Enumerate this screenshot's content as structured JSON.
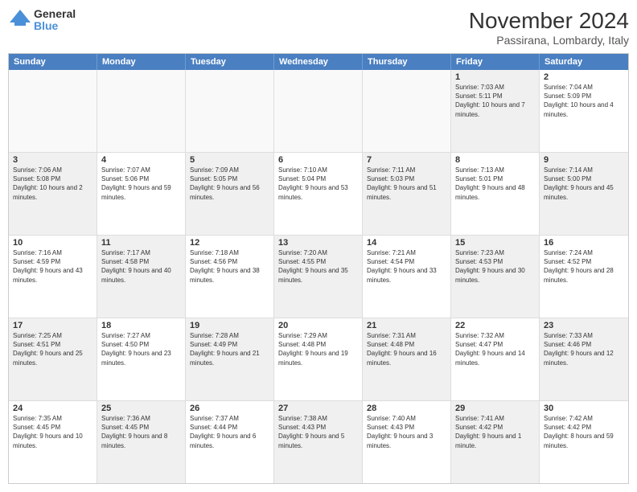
{
  "logo": {
    "general": "General",
    "blue": "Blue"
  },
  "header": {
    "month": "November 2024",
    "location": "Passirana, Lombardy, Italy"
  },
  "days_of_week": [
    "Sunday",
    "Monday",
    "Tuesday",
    "Wednesday",
    "Thursday",
    "Friday",
    "Saturday"
  ],
  "rows": [
    [
      {
        "day": "",
        "info": "",
        "empty": true
      },
      {
        "day": "",
        "info": "",
        "empty": true
      },
      {
        "day": "",
        "info": "",
        "empty": true
      },
      {
        "day": "",
        "info": "",
        "empty": true
      },
      {
        "day": "",
        "info": "",
        "empty": true
      },
      {
        "day": "1",
        "info": "Sunrise: 7:03 AM\nSunset: 5:11 PM\nDaylight: 10 hours and 7 minutes.",
        "shaded": true
      },
      {
        "day": "2",
        "info": "Sunrise: 7:04 AM\nSunset: 5:09 PM\nDaylight: 10 hours and 4 minutes.",
        "shaded": false
      }
    ],
    [
      {
        "day": "3",
        "info": "Sunrise: 7:06 AM\nSunset: 5:08 PM\nDaylight: 10 hours and 2 minutes.",
        "shaded": true
      },
      {
        "day": "4",
        "info": "Sunrise: 7:07 AM\nSunset: 5:06 PM\nDaylight: 9 hours and 59 minutes.",
        "shaded": false
      },
      {
        "day": "5",
        "info": "Sunrise: 7:09 AM\nSunset: 5:05 PM\nDaylight: 9 hours and 56 minutes.",
        "shaded": true
      },
      {
        "day": "6",
        "info": "Sunrise: 7:10 AM\nSunset: 5:04 PM\nDaylight: 9 hours and 53 minutes.",
        "shaded": false
      },
      {
        "day": "7",
        "info": "Sunrise: 7:11 AM\nSunset: 5:03 PM\nDaylight: 9 hours and 51 minutes.",
        "shaded": true
      },
      {
        "day": "8",
        "info": "Sunrise: 7:13 AM\nSunset: 5:01 PM\nDaylight: 9 hours and 48 minutes.",
        "shaded": false
      },
      {
        "day": "9",
        "info": "Sunrise: 7:14 AM\nSunset: 5:00 PM\nDaylight: 9 hours and 45 minutes.",
        "shaded": true
      }
    ],
    [
      {
        "day": "10",
        "info": "Sunrise: 7:16 AM\nSunset: 4:59 PM\nDaylight: 9 hours and 43 minutes.",
        "shaded": false
      },
      {
        "day": "11",
        "info": "Sunrise: 7:17 AM\nSunset: 4:58 PM\nDaylight: 9 hours and 40 minutes.",
        "shaded": true
      },
      {
        "day": "12",
        "info": "Sunrise: 7:18 AM\nSunset: 4:56 PM\nDaylight: 9 hours and 38 minutes.",
        "shaded": false
      },
      {
        "day": "13",
        "info": "Sunrise: 7:20 AM\nSunset: 4:55 PM\nDaylight: 9 hours and 35 minutes.",
        "shaded": true
      },
      {
        "day": "14",
        "info": "Sunrise: 7:21 AM\nSunset: 4:54 PM\nDaylight: 9 hours and 33 minutes.",
        "shaded": false
      },
      {
        "day": "15",
        "info": "Sunrise: 7:23 AM\nSunset: 4:53 PM\nDaylight: 9 hours and 30 minutes.",
        "shaded": true
      },
      {
        "day": "16",
        "info": "Sunrise: 7:24 AM\nSunset: 4:52 PM\nDaylight: 9 hours and 28 minutes.",
        "shaded": false
      }
    ],
    [
      {
        "day": "17",
        "info": "Sunrise: 7:25 AM\nSunset: 4:51 PM\nDaylight: 9 hours and 25 minutes.",
        "shaded": true
      },
      {
        "day": "18",
        "info": "Sunrise: 7:27 AM\nSunset: 4:50 PM\nDaylight: 9 hours and 23 minutes.",
        "shaded": false
      },
      {
        "day": "19",
        "info": "Sunrise: 7:28 AM\nSunset: 4:49 PM\nDaylight: 9 hours and 21 minutes.",
        "shaded": true
      },
      {
        "day": "20",
        "info": "Sunrise: 7:29 AM\nSunset: 4:48 PM\nDaylight: 9 hours and 19 minutes.",
        "shaded": false
      },
      {
        "day": "21",
        "info": "Sunrise: 7:31 AM\nSunset: 4:48 PM\nDaylight: 9 hours and 16 minutes.",
        "shaded": true
      },
      {
        "day": "22",
        "info": "Sunrise: 7:32 AM\nSunset: 4:47 PM\nDaylight: 9 hours and 14 minutes.",
        "shaded": false
      },
      {
        "day": "23",
        "info": "Sunrise: 7:33 AM\nSunset: 4:46 PM\nDaylight: 9 hours and 12 minutes.",
        "shaded": true
      }
    ],
    [
      {
        "day": "24",
        "info": "Sunrise: 7:35 AM\nSunset: 4:45 PM\nDaylight: 9 hours and 10 minutes.",
        "shaded": false
      },
      {
        "day": "25",
        "info": "Sunrise: 7:36 AM\nSunset: 4:45 PM\nDaylight: 9 hours and 8 minutes.",
        "shaded": true
      },
      {
        "day": "26",
        "info": "Sunrise: 7:37 AM\nSunset: 4:44 PM\nDaylight: 9 hours and 6 minutes.",
        "shaded": false
      },
      {
        "day": "27",
        "info": "Sunrise: 7:38 AM\nSunset: 4:43 PM\nDaylight: 9 hours and 5 minutes.",
        "shaded": true
      },
      {
        "day": "28",
        "info": "Sunrise: 7:40 AM\nSunset: 4:43 PM\nDaylight: 9 hours and 3 minutes.",
        "shaded": false
      },
      {
        "day": "29",
        "info": "Sunrise: 7:41 AM\nSunset: 4:42 PM\nDaylight: 9 hours and 1 minute.",
        "shaded": true
      },
      {
        "day": "30",
        "info": "Sunrise: 7:42 AM\nSunset: 4:42 PM\nDaylight: 8 hours and 59 minutes.",
        "shaded": false
      }
    ]
  ]
}
